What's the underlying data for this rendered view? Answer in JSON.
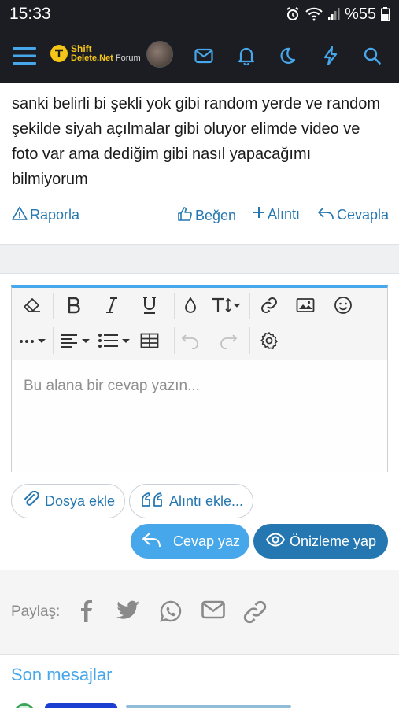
{
  "status_bar": {
    "time": "15:33",
    "battery": "%55"
  },
  "header": {
    "logo": {
      "line1": "Shift",
      "line2_brand": "Delete.Net",
      "line2_suffix": "Forum"
    }
  },
  "post": {
    "text": "sanki belirli bi şekli yok gibi random yerde ve random şekilde siyah açılmalar gibi oluyor elimde video ve foto var ama dediğim gibi nasıl yapacağımı bilmiyorum"
  },
  "actions": {
    "report": "Raporla",
    "like": "Beğen",
    "quote": "Alıntı",
    "reply": "Cevapla"
  },
  "editor": {
    "placeholder": "Bu alana bir cevap yazın..."
  },
  "buttons": {
    "attach": "Dosya ekle",
    "insert_quotes": "Alıntı ekle...",
    "post_reply": "Cevap yaz",
    "preview": "Önizleme yap"
  },
  "share": {
    "label": "Paylaş:"
  },
  "recent": {
    "title": "Son mesajlar"
  },
  "colors": {
    "accent": "#47a7eb",
    "link": "#2577b1",
    "header_bg": "#1c1d22",
    "logo": "#f5c518"
  }
}
